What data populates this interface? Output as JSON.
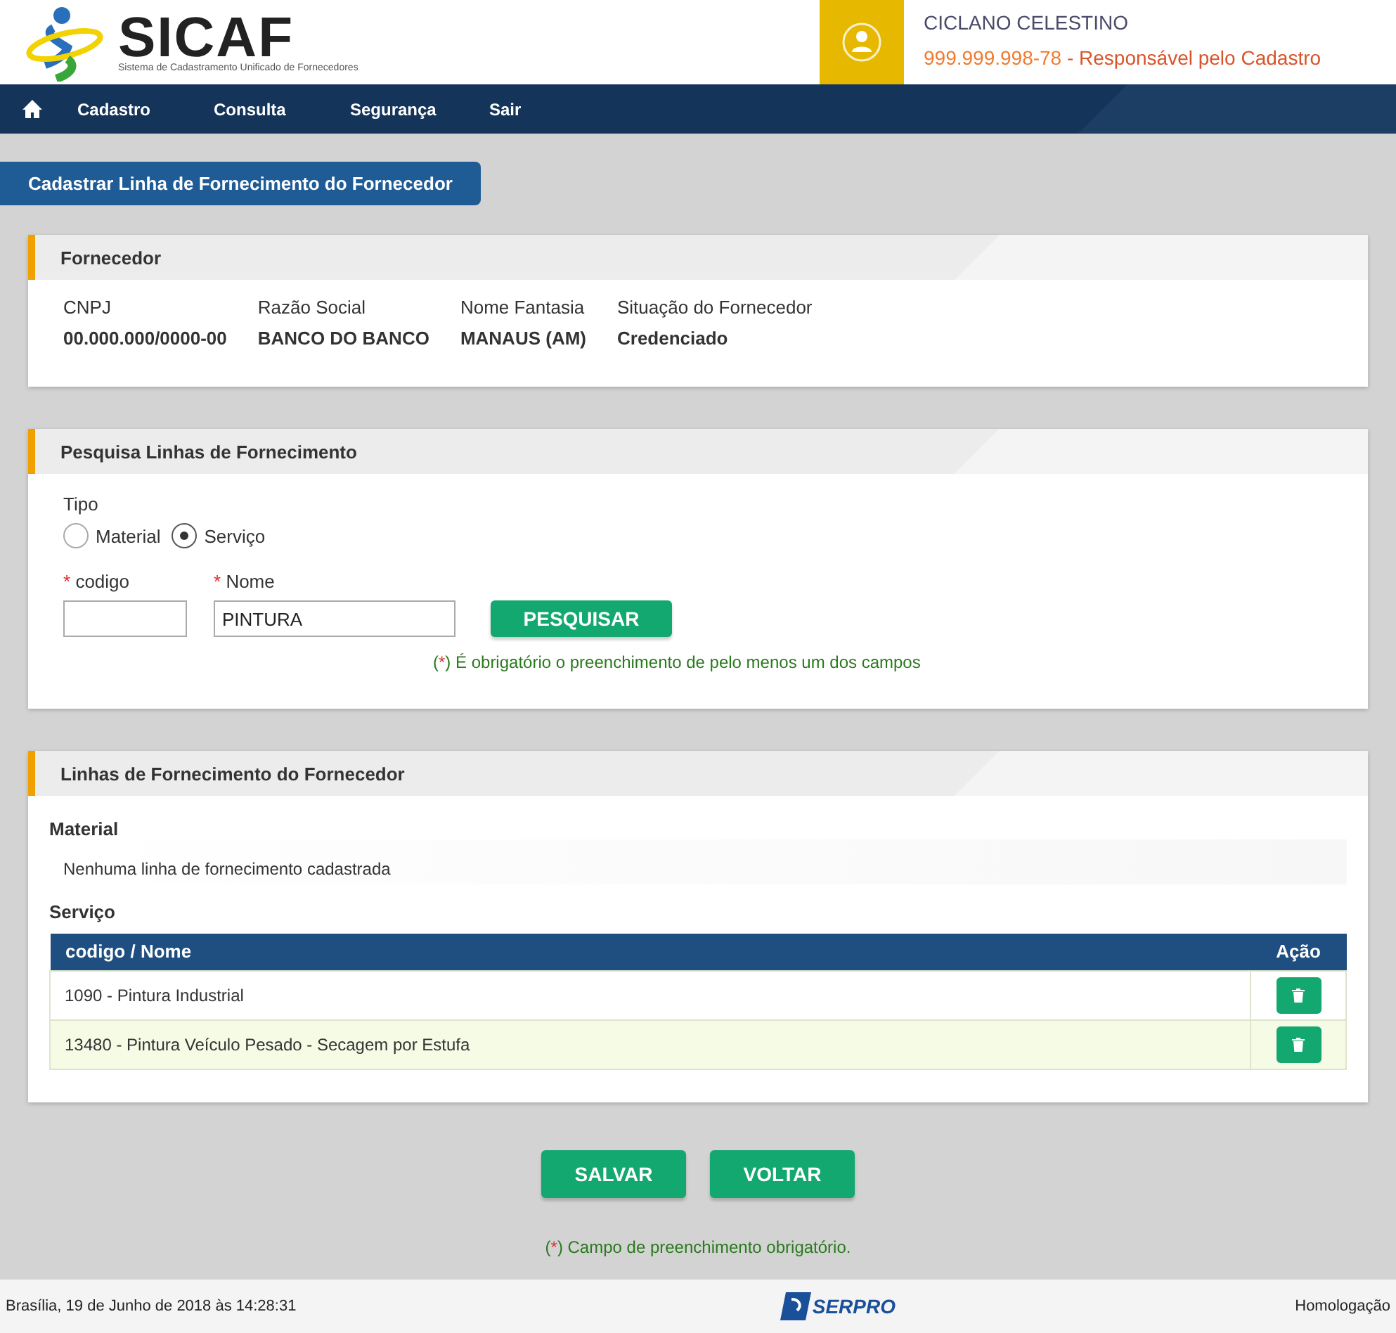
{
  "header": {
    "logo_title": "SICAF",
    "logo_subtitle": "Sistema de Cadastramento Unificado de Fornecedores",
    "user_name": "CICLANO CELESTINO",
    "user_cpf": "999.999.998-78",
    "user_role": "- Responsável pelo Cadastro"
  },
  "nav": {
    "items": [
      "Cadastro",
      "Consulta",
      "Segurança",
      "Sair"
    ]
  },
  "page_title": "Cadastrar Linha de Fornecimento do Fornecedor",
  "supplier": {
    "title": "Fornecedor",
    "fields": [
      {
        "label": "CNPJ",
        "value": "00.000.000/0000-00"
      },
      {
        "label": "Razão Social",
        "value": "BANCO DO BANCO"
      },
      {
        "label": "Nome Fantasia",
        "value": "MANAUS (AM)"
      },
      {
        "label": "Situação do Fornecedor",
        "value": "Credenciado"
      }
    ]
  },
  "search": {
    "title": "Pesquisa Linhas de Fornecimento",
    "type_label": "Tipo",
    "types": [
      {
        "label": "Material",
        "selected": false
      },
      {
        "label": "Serviço",
        "selected": true
      }
    ],
    "required_mark": "*",
    "code_label": "codigo",
    "name_label": "Nome",
    "name_value": "PINTURA",
    "button": "PESQUISAR",
    "note": {
      "open": "(",
      "mark": "*",
      "rest": ") É obrigatório o preenchimento de pelo menos um dos campos"
    }
  },
  "lines": {
    "title": "Linhas de Fornecimento do Fornecedor",
    "material_label": "Material",
    "material_empty": "Nenhuma linha de fornecimento cadastrada",
    "service_label": "Serviço",
    "columns": [
      "codigo / Nome",
      "Ação"
    ],
    "rows": [
      {
        "text": "1090 - Pintura Industrial"
      },
      {
        "text": "13480 - Pintura Veículo Pesado - Secagem por Estufa"
      }
    ]
  },
  "buttons": [
    "SALVAR",
    "VOLTAR"
  ],
  "footer_note": {
    "open": "(",
    "mark": "*",
    "rest": ") Campo de preenchimento obrigatório."
  },
  "status_bar": {
    "datetime": "Brasília, 19 de Junho de 2018 às 14:28:31",
    "brand": "SERPRO",
    "environment": "Homologação"
  }
}
